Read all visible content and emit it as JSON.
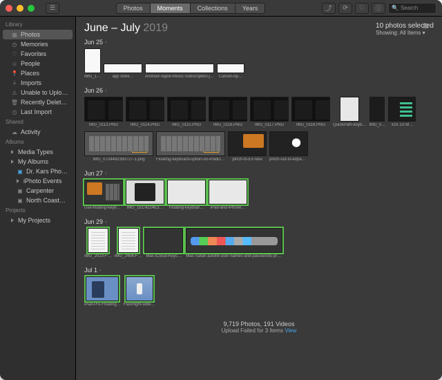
{
  "tabs": {
    "t1": "Photos",
    "t2": "Moments",
    "t3": "Collections",
    "t4": "Years"
  },
  "search_placeholder": "Search",
  "sidebar": {
    "library_h": "Library",
    "photos": "Photos",
    "memories": "Memories",
    "favorites": "Favorites",
    "people": "People",
    "places": "Places",
    "imports": "Imports",
    "unable": "Unable to Uplo…",
    "recent": "Recently Delet…",
    "last": "Last Import",
    "shared_h": "Shared",
    "activity": "Activity",
    "albums_h": "Albums",
    "media": "Media Types",
    "myalbums": "My Albums",
    "drkars": "Dr. Kars Pho…",
    "iphoto": "iPhoto Events",
    "carpenter": "Carpenter",
    "north": "North Coast…",
    "projects_h": "Projects",
    "myprojects": "My Projects"
  },
  "header": {
    "title_a": "June – July",
    "title_b": "2019",
    "selected": "10 photos selected",
    "showing": "Showing: All Items ▾"
  },
  "dates": {
    "d1": "Jun 25",
    "d2": "Jun 26",
    "d3": "Jun 27",
    "d4": "Jun 29",
    "d5": "Jul 1"
  },
  "caps": {
    "img1": "IMG_1…",
    "appstore": "app store…",
    "android": "Android-Apple-Music-Subscription.jpg",
    "cancel": "Cancel-Ap…",
    "s0113": "IMG_0113.PNG",
    "s0114": "IMG_0114.PNG",
    "s0115": "IMG_0115.PNG",
    "s0116": "IMG_0116.PNG",
    "s0117": "IMG_0117.PNG",
    "s0118": "IMG_0118.PNG",
    "quick": "QuickPath-keyb…",
    "imgq": "IMG_0…",
    "ios13": "iOS-13-M…",
    "longimg": "IMG_0724492393727-1.png",
    "floatopt": "Floating-keyboard-option-on-iPadOS-full-size-keyboard…",
    "pinchto": "pinch-to-Ex-new",
    "pinchout": "pinch-out-to-expand-floating-keyboard-t…",
    "grab": "Use-floating-keyboard-handle-to-spring-b…",
    "img1ec": "IMG_1EC4224E3…",
    "floatkb": "Floating-keyboar…",
    "ipadiphone": "iPad-and-iPhone…",
    "img2023": "IMG_2023-F…",
    "img2456": "IMG_2456-F…",
    "icloud": "Mac-iCloud-Keyc…",
    "safari": "Mac-Safari-autofill-user-names-and-passwords-preferences-che…",
    "ipadpro": "iPad-Pro-Floating…",
    "flashlight": "Flashlight-wide…"
  },
  "footer": {
    "count": "9,719 Photos, 191 Videos",
    "fail_a": "Upload Failed for 3 Items",
    "fail_link": "View"
  }
}
